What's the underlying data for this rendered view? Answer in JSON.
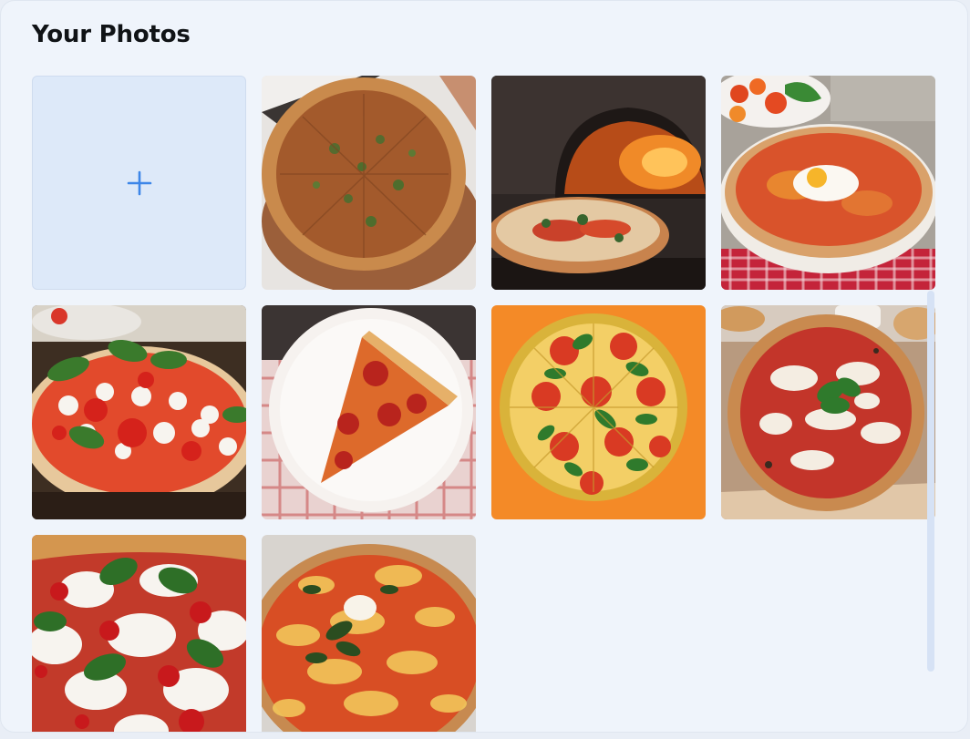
{
  "title": "Your Photos",
  "add_photo": {
    "icon": "plus-icon",
    "color": "#3d86e8"
  },
  "photos": [
    {
      "name": "photo-pizza-wood-board"
    },
    {
      "name": "photo-pizza-oven"
    },
    {
      "name": "photo-pizza-egg"
    },
    {
      "name": "photo-pizza-caprese"
    },
    {
      "name": "photo-pizza-slice-plate"
    },
    {
      "name": "photo-pizza-orange-background"
    },
    {
      "name": "photo-pizza-margherita-board"
    },
    {
      "name": "photo-pizza-mozzarella-basil"
    },
    {
      "name": "photo-pizza-cheesy"
    }
  ]
}
